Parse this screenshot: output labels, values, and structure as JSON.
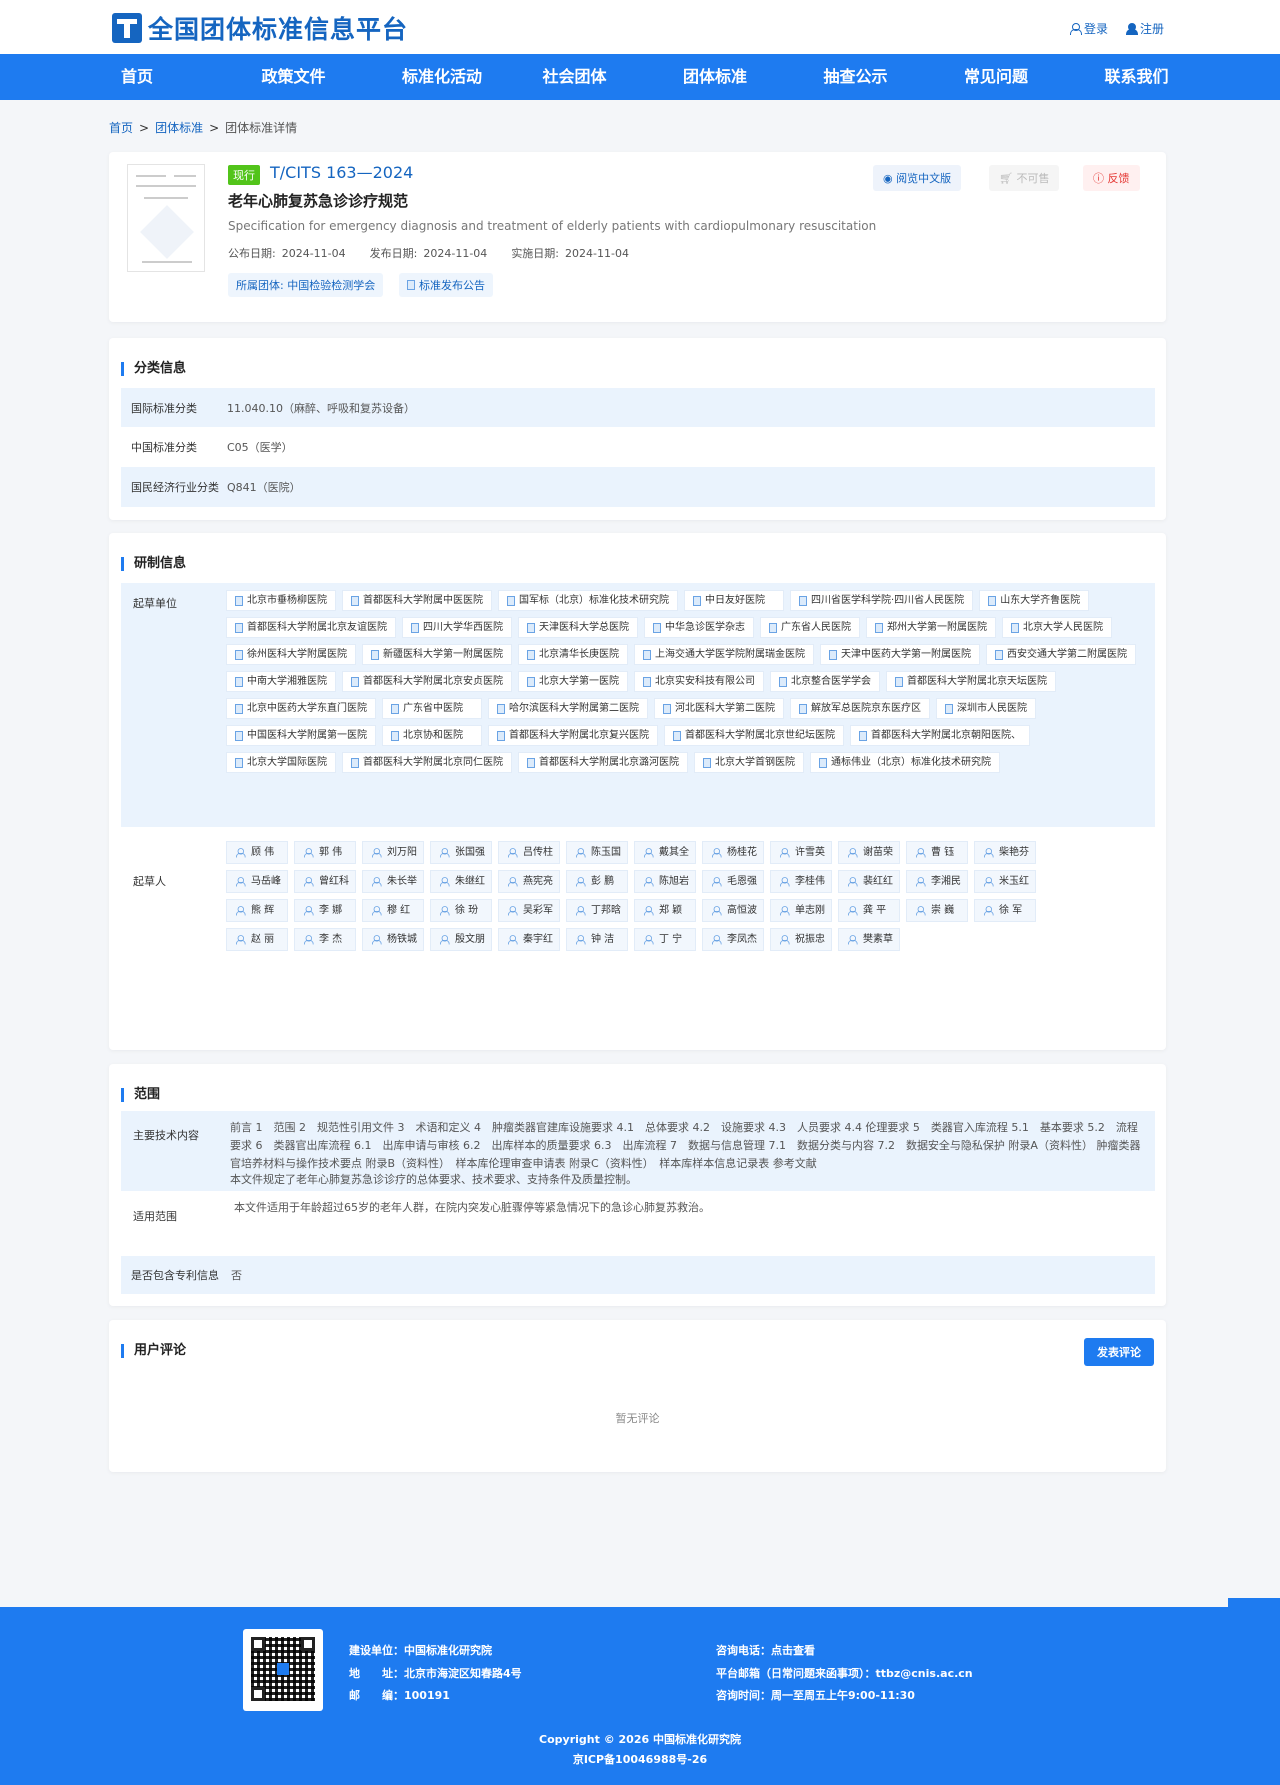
{
  "header": {
    "logo": "全国团体标准信息平台",
    "login": "登录",
    "register": "注册"
  },
  "nav": [
    "首页",
    "政策文件",
    "标准化活动",
    "社会团体",
    "团体标准",
    "抽查公示",
    "常见问题",
    "联系我们"
  ],
  "breadcrumb": {
    "home": "首页",
    "standards": "团体标准",
    "current": "团体标准详情",
    "sep": ">"
  },
  "standard": {
    "status": "现行",
    "code": "T/CITS 163—2024",
    "title": "老年心肺复苏急诊诊疗规范",
    "title_en": "Specification for emergency diagnosis and treatment of elderly patients with cardiopulmonary resuscitation",
    "publish_label": "公布日期:",
    "publish_date": "2024-11-04",
    "release_label": "发布日期:",
    "release_date": "2024-11-04",
    "impl_label": "实施日期:",
    "impl_date": "2024-11-04",
    "org_pill": "所属团体: 中国检验检测学会",
    "notice_pill": "标准发布公告",
    "read_btn": "阅览中文版",
    "buy_btn": "不可售",
    "feedback_btn": "反馈"
  },
  "classification": {
    "title": "分类信息",
    "rows": [
      {
        "k": "国际标准分类",
        "v": "11.040.10（麻醉、呼吸和复苏设备）"
      },
      {
        "k": "中国标准分类",
        "v": "C05（医学）"
      },
      {
        "k": "国民经济行业分类",
        "v": "Q841（医院）"
      }
    ]
  },
  "research": {
    "title": "研制信息",
    "org_label": "起草单位",
    "orgs": [
      "北京市垂杨柳医院",
      "首都医科大学附属中医医院",
      "国军标（北京）标准化技术研究院",
      "中日友好医院",
      "四川省医学科学院·四川省人民医院",
      "山东大学齐鲁医院",
      "首都医科大学附属北京友谊医院",
      "四川大学华西医院",
      "天津医科大学总医院",
      "中华急诊医学杂志",
      "广东省人民医院",
      "郑州大学第一附属医院",
      "北京大学人民医院",
      "徐州医科大学附属医院",
      "新疆医科大学第一附属医院",
      "北京清华长庚医院",
      "上海交通大学医学院附属瑞金医院",
      "天津中医药大学第一附属医院",
      "西安交通大学第二附属医院",
      "中南大学湘雅医院",
      "首都医科大学附属北京安贞医院",
      "北京大学第一医院",
      "北京实安科技有限公司",
      "北京整合医学学会",
      "首都医科大学附属北京天坛医院",
      "北京中医药大学东直门医院",
      "广东省中医院",
      "哈尔滨医科大学附属第二医院",
      "河北医科大学第二医院",
      "解放军总医院京东医疗区",
      "深圳市人民医院",
      "中国医科大学附属第一医院",
      "北京协和医院",
      "首都医科大学附属北京复兴医院",
      "首都医科大学附属北京世纪坛医院",
      "首都医科大学附属北京朝阳医院、",
      "北京大学国际医院",
      "首都医科大学附属北京同仁医院",
      "首都医科大学附属北京潞河医院",
      "北京大学首钢医院",
      "通标伟业（北京）标准化技术研究院"
    ],
    "person_label": "起草人",
    "persons": [
      "顾 伟",
      "郭 伟",
      "刘万阳",
      "张国强",
      "吕传柱",
      "陈玉国",
      "戴其全",
      "杨桂花",
      "许雪英",
      "谢苗荣",
      "曹 钰",
      "柴艳芬",
      "马岳峰",
      "曾红科",
      "朱长举",
      "朱继红",
      "燕宪亮",
      "彭 鹏",
      "陈旭岩",
      "毛恩强",
      "李桂伟",
      "裴红红",
      "李湘民",
      "米玉红",
      "熊 辉",
      "李 娜",
      "穆 红",
      "徐 玢",
      "吴彩军",
      "丁邦晗",
      "郑 颖",
      "高恒波",
      "单志刚",
      "龚 平",
      "崇 巍",
      "徐 军",
      "赵 丽",
      "李 杰",
      "杨铁城",
      "殷文朋",
      "秦宇红",
      "钟 洁",
      "丁 宁",
      "李凤杰",
      "祝振忠",
      "樊素草"
    ]
  },
  "scope": {
    "title": "范围",
    "content_label": "主要技术内容",
    "content": "前言 1　范围 2　规范性引用文件 3　术语和定义 4　肿瘤类器官建库设施要求 4.1　总体要求 4.2　设施要求 4.3　人员要求 4.4 伦理要求 5　类器官入库流程 5.1　基本要求 5.2　流程要求 6　类器官出库流程 6.1　出库申请与审核 6.2　出库样本的质量要求 6.3　出库流程 7　数据与信息管理 7.1　数据分类与内容 7.2　数据安全与隐私保护 附录A（资料性） 肿瘤类器官培养材料与操作技术要点 附录B（资料性）　样本库伦理审查申请表 附录C（资料性）　样本库样本信息记录表 参考文献",
    "content2": "本文件规定了老年心肺复苏急诊诊疗的总体要求、技术要求、支持条件及质量控制。",
    "apply_label": "适用范围",
    "apply": "本文件适用于年龄超过65岁的老年人群，在院内突发心脏骤停等紧急情况下的急诊心肺复苏救治。",
    "patent_label": "是否包含专利信息",
    "patent": "否"
  },
  "comments": {
    "title": "用户评论",
    "button": "发表评论",
    "empty": "暂无评论"
  },
  "footer": {
    "builder": "建设单位：中国标准化研究院",
    "address": "地　　址：北京市海淀区知春路4号",
    "zip": "邮　　编：100191",
    "phone": "咨询电话：点击查看",
    "email": "平台邮箱（日常问题来函事项）：ttbz@cnis.ac.cn",
    "hours": "咨询时间：周一至周五上午9:00-11:30",
    "copyright": "Copyright © 2026 中国标准化研究院",
    "icp": "京ICP备10046988号-26"
  }
}
